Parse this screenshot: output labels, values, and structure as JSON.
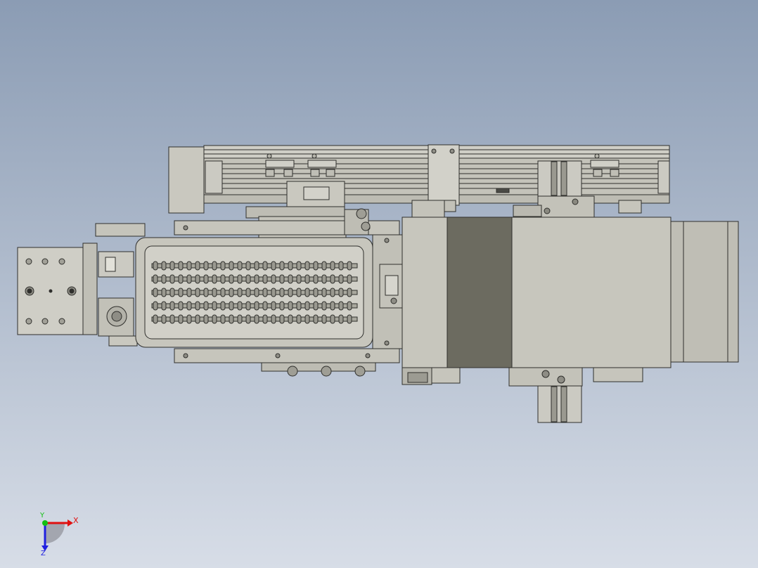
{
  "viewport": {
    "background_top": "#8b9cb4",
    "background_bottom": "#d7dde7"
  },
  "palette": {
    "part": "#c7c6bd",
    "part_light": "#d3d2ca",
    "part_dark": "#a9a89e",
    "band": "#6c6b60",
    "line": "#2f2f2c",
    "hole": "#9a9990"
  },
  "triad": {
    "x_label": "X",
    "y_label": "Y",
    "z_label": "Z",
    "x_color": "#e01010",
    "y_color": "#12c012",
    "z_color": "#2020e0"
  }
}
